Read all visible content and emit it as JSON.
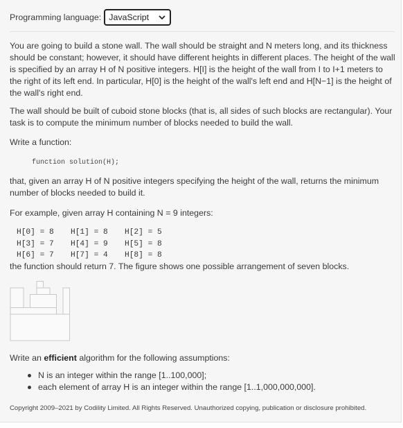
{
  "header": {
    "language_label": "Programming language:",
    "language_selected": "JavaScript"
  },
  "task": {
    "paragraph1": "You are going to build a stone wall. The wall should be straight and N meters long, and its thickness should be constant; however, it should have different heights in different places. The height of the wall is specified by an array H of N positive integers. H[I] is the height of the wall from I to I+1 meters to the right of its left end. In particular, H[0] is the height of the wall's left end and H[N−1] is the height of the wall's right end.",
    "paragraph2": "The wall should be built of cuboid stone blocks (that is, all sides of such blocks are rectangular). Your task is to compute the minimum number of blocks needed to build the wall.",
    "paragraph3": "Write a function:",
    "signature": "function solution(H);",
    "paragraph4": "that, given an array H of N positive integers specifying the height of the wall, returns the minimum number of blocks needed to build it.",
    "paragraph5": "For example, given array H containing N = 9 integers:",
    "array_rows": [
      [
        "H[0] = 8",
        "H[1] = 8",
        "H[2] = 5"
      ],
      [
        "H[3] = 7",
        "H[4] = 9",
        "H[5] = 8"
      ],
      [
        "H[6] = 7",
        "H[7] = 4",
        "H[8] = 8"
      ]
    ],
    "paragraph6": "the function should return 7. The figure shows one possible arrangement of seven blocks.",
    "paragraph7_prefix": "Write an ",
    "paragraph7_strong": "efficient",
    "paragraph7_suffix": " algorithm for the following assumptions:",
    "assumptions": [
      "N is an integer within the range [1..100,000];",
      "each element of array H is an integer within the range [1..1,000,000,000]."
    ]
  },
  "footer": {
    "copyright": "Copyright 2009–2021 by Codility Limited. All Rights Reserved. Unauthorized copying, publication or disclosure prohibited."
  },
  "figure": {
    "heights": [
      8,
      8,
      5,
      7,
      9,
      8,
      7,
      4,
      8
    ],
    "block_count": 7,
    "stroke_color": "#c8c8c8"
  }
}
